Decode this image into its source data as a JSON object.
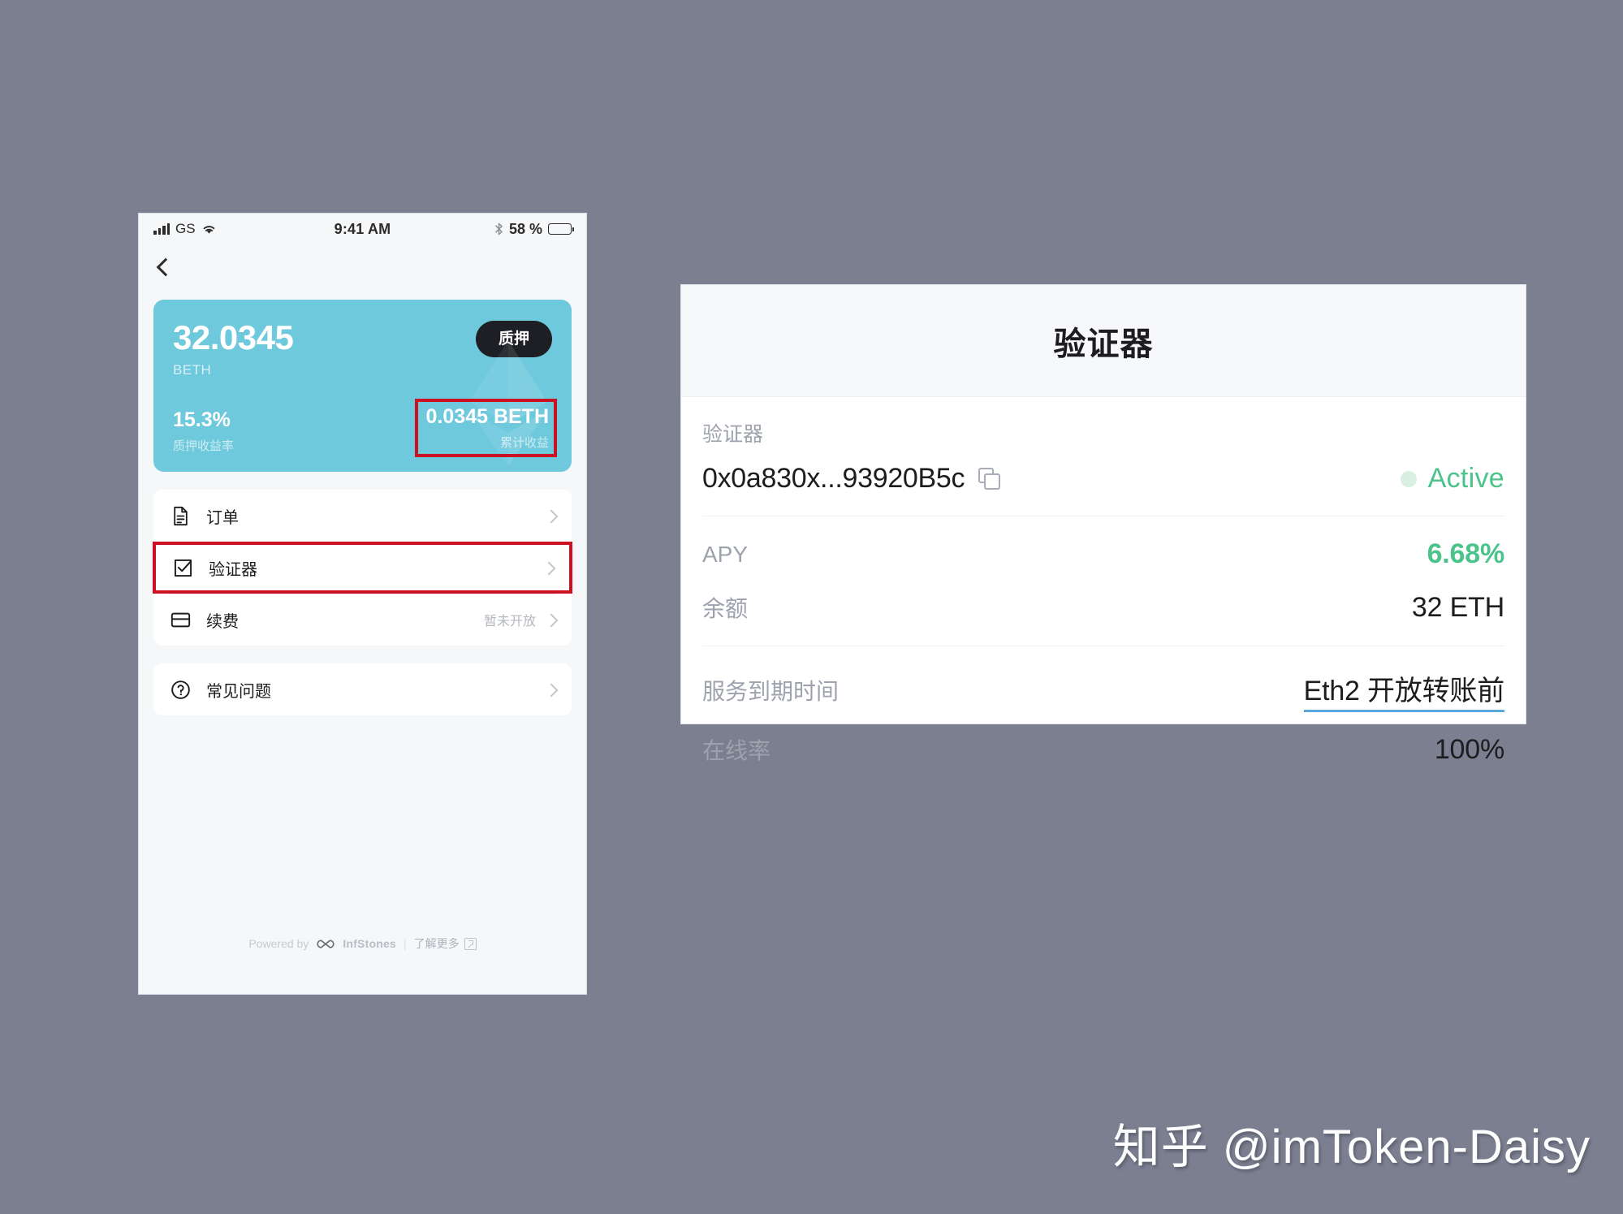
{
  "phone": {
    "status_bar": {
      "carrier": "GS",
      "time": "9:41 AM",
      "battery_percent": "58 %",
      "battery_level": 58,
      "signal_icon": "signal-bars-icon",
      "wifi_icon": "wifi-icon",
      "bluetooth_icon": "bluetooth-icon",
      "battery_icon": "battery-icon"
    },
    "nav": {
      "back_icon": "back-chevron-icon"
    },
    "balance_card": {
      "amount": "32.0345",
      "symbol": "BETH",
      "stake_button": "质押",
      "bg_color": "#6fc9dd",
      "apr_value": "15.3%",
      "apr_label": "质押收益率",
      "rewards_value": "0.0345 BETH",
      "rewards_label": "累计收益",
      "rewards_highlighted": true,
      "highlight_color": "#cc1122"
    },
    "menu": [
      {
        "label": "订单",
        "icon": "document-icon",
        "note": "",
        "highlighted": false
      },
      {
        "label": "验证器",
        "icon": "checkbox-check-icon",
        "note": "",
        "highlighted": true
      },
      {
        "label": "续费",
        "icon": "card-icon",
        "note": "暂未开放",
        "highlighted": false
      }
    ],
    "menu_secondary": [
      {
        "label": "常见问题",
        "icon": "question-circle-icon",
        "note": "",
        "highlighted": false
      }
    ],
    "footer": {
      "powered_by": "Powered by",
      "brand": "InfStones",
      "brand_icon": "infinity-icon",
      "separator": "|",
      "learn_more": "了解更多",
      "external_link_icon": "external-link-icon"
    }
  },
  "panel": {
    "title": "验证器",
    "validator": {
      "label": "验证器",
      "address": "0x0a830x...93920B5c",
      "copy_icon": "copy-icon",
      "status": "Active",
      "status_color": "#4cc38a",
      "status_dot_color": "#d8f0e0"
    },
    "details": [
      {
        "key": "APY",
        "value": "6.68%",
        "style": "accent"
      },
      {
        "key": "余额",
        "value": "32 ETH",
        "style": "plain"
      }
    ],
    "service": [
      {
        "key": "服务到期时间",
        "value": "Eth2 开放转账前",
        "style": "link"
      },
      {
        "key": "在线率",
        "value": "100%",
        "style": "plain"
      }
    ]
  },
  "watermark": {
    "text": "知乎 @imToken-Daisy"
  }
}
